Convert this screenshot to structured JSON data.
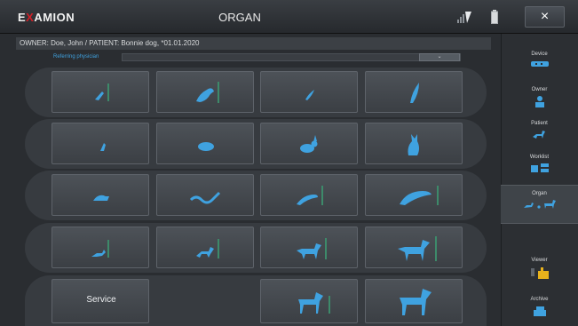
{
  "app": {
    "logo_prefix": "E",
    "logo_x": "X",
    "logo_suffix": "AMION",
    "title": "ORGAN",
    "close_label": "×"
  },
  "header": {
    "owner_patient": "OWNER: Doe, John / PATIENT: Bonnie dog, *01.01.2020"
  },
  "referring": {
    "label": "Referring physician",
    "value": "",
    "dropdown": "⌄"
  },
  "organ_grid": {
    "rows": [
      [
        "bird-small",
        "bird-large",
        "feather-small",
        "feather-large"
      ],
      [
        "reptile-small",
        "rodent",
        "rabbit",
        "cat"
      ],
      [
        "turtle",
        "snake",
        "lizard-small",
        "lizard-large"
      ],
      [
        "dog-small",
        "dog-medium",
        "dog-large",
        "dog-xlarge"
      ],
      [
        "service",
        "empty",
        "horse-small",
        "horse-large"
      ]
    ],
    "service_label": "Service"
  },
  "sidebar": {
    "items": [
      {
        "label": "Device",
        "icon": "device-icon"
      },
      {
        "label": "Owner",
        "icon": "owner-icon"
      },
      {
        "label": "Patient",
        "icon": "patient-icon"
      },
      {
        "label": "Worklist",
        "icon": "worklist-icon"
      },
      {
        "label": "Organ",
        "icon": "organ-icon",
        "active": true
      },
      {
        "label": "Viewer",
        "icon": "viewer-icon"
      },
      {
        "label": "Archive",
        "icon": "archive-icon"
      }
    ]
  },
  "colors": {
    "accent_blue": "#3fa2e0",
    "logo_red": "#d21f27",
    "viewer_yellow": "#e8b21c"
  }
}
